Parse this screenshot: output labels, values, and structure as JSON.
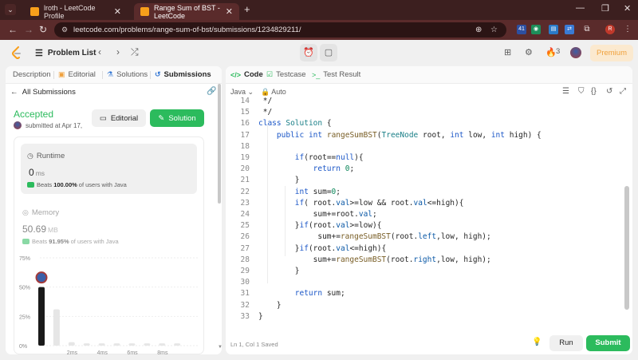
{
  "browser": {
    "tabs": [
      {
        "title": "lroth - LeetCode Profile",
        "active": false
      },
      {
        "title": "Range Sum of BST - LeetCode",
        "active": true
      }
    ],
    "url": "leetcode.com/problems/range-sum-of-bst/submissions/1234829211/",
    "extension_badge": "41",
    "profile_initial": "R"
  },
  "lc_nav": {
    "problem_list": "Problem List",
    "streak": "3",
    "premium": "Premium"
  },
  "left": {
    "tabs": [
      "Description",
      "Editorial",
      "Solutions",
      "Submissions"
    ],
    "all_submissions": "All Submissions",
    "status": "Accepted",
    "submitted": "submitted at Apr 17,",
    "editorial_btn": "Editorial",
    "solution_btn": "Solution",
    "runtime": {
      "label": "Runtime",
      "value": "0",
      "unit": "ms",
      "beats_value": "100.00%",
      "beats_text": "of users with Java"
    },
    "memory": {
      "label": "Memory",
      "value": "50.69",
      "unit": "MB",
      "beats_value": "91.95%",
      "beats_text": "of users with Java"
    }
  },
  "chart_data": {
    "type": "bar",
    "yticks": [
      "75%",
      "50%",
      "25%",
      "0%"
    ],
    "xticks": [
      "2ms",
      "4ms",
      "6ms",
      "8ms"
    ],
    "ylim": [
      0,
      75
    ],
    "bars": [
      {
        "x": "0ms",
        "value": 50,
        "highlight": true
      },
      {
        "x": "1ms",
        "value": 31,
        "highlight": false
      },
      {
        "x": "2ms",
        "value": 3,
        "highlight": false
      },
      {
        "x": "3ms",
        "value": 2,
        "highlight": false
      },
      {
        "x": "4ms",
        "value": 2,
        "highlight": false
      },
      {
        "x": "5ms",
        "value": 2,
        "highlight": false
      },
      {
        "x": "6ms",
        "value": 2,
        "highlight": false
      },
      {
        "x": "7ms",
        "value": 2,
        "highlight": false
      },
      {
        "x": "8ms",
        "value": 2,
        "highlight": false
      },
      {
        "x": "9ms",
        "value": 2,
        "highlight": false
      }
    ]
  },
  "right": {
    "tabs": [
      "Code",
      "Testcase",
      "Test Result"
    ],
    "language": "Java",
    "autosave": "Auto",
    "status": "Ln 1, Col 1    Saved",
    "run_btn": "Run",
    "submit_btn": "Submit",
    "lines": [
      {
        "n": "14",
        "code": " */"
      },
      {
        "n": "15",
        "code": " */"
      },
      {
        "n": "16",
        "code": "class Solution {"
      },
      {
        "n": "17",
        "code": "    public int rangeSumBST(TreeNode root, int low, int high) {"
      },
      {
        "n": "18",
        "code": ""
      },
      {
        "n": "19",
        "code": "        if(root==null){"
      },
      {
        "n": "20",
        "code": "            return 0;"
      },
      {
        "n": "21",
        "code": "        }"
      },
      {
        "n": "22",
        "code": "        int sum=0;"
      },
      {
        "n": "23",
        "code": "        if( root.val>=low && root.val<=high){"
      },
      {
        "n": "24",
        "code": "            sum+=root.val;"
      },
      {
        "n": "25",
        "code": "        }if(root.val>=low){"
      },
      {
        "n": "26",
        "code": "             sum+=rangeSumBST(root.left,low, high);"
      },
      {
        "n": "27",
        "code": "        }if(root.val<=high){"
      },
      {
        "n": "28",
        "code": "            sum+=rangeSumBST(root.right,low, high);"
      },
      {
        "n": "29",
        "code": "        }"
      },
      {
        "n": "30",
        "code": ""
      },
      {
        "n": "31",
        "code": "        return sum;"
      },
      {
        "n": "32",
        "code": "    }"
      },
      {
        "n": "33",
        "code": "}"
      }
    ]
  },
  "colors": {
    "accent_green": "#2cbb5d",
    "premium_orange": "#f0a13c",
    "chrome_dark": "#3c1f1f"
  }
}
